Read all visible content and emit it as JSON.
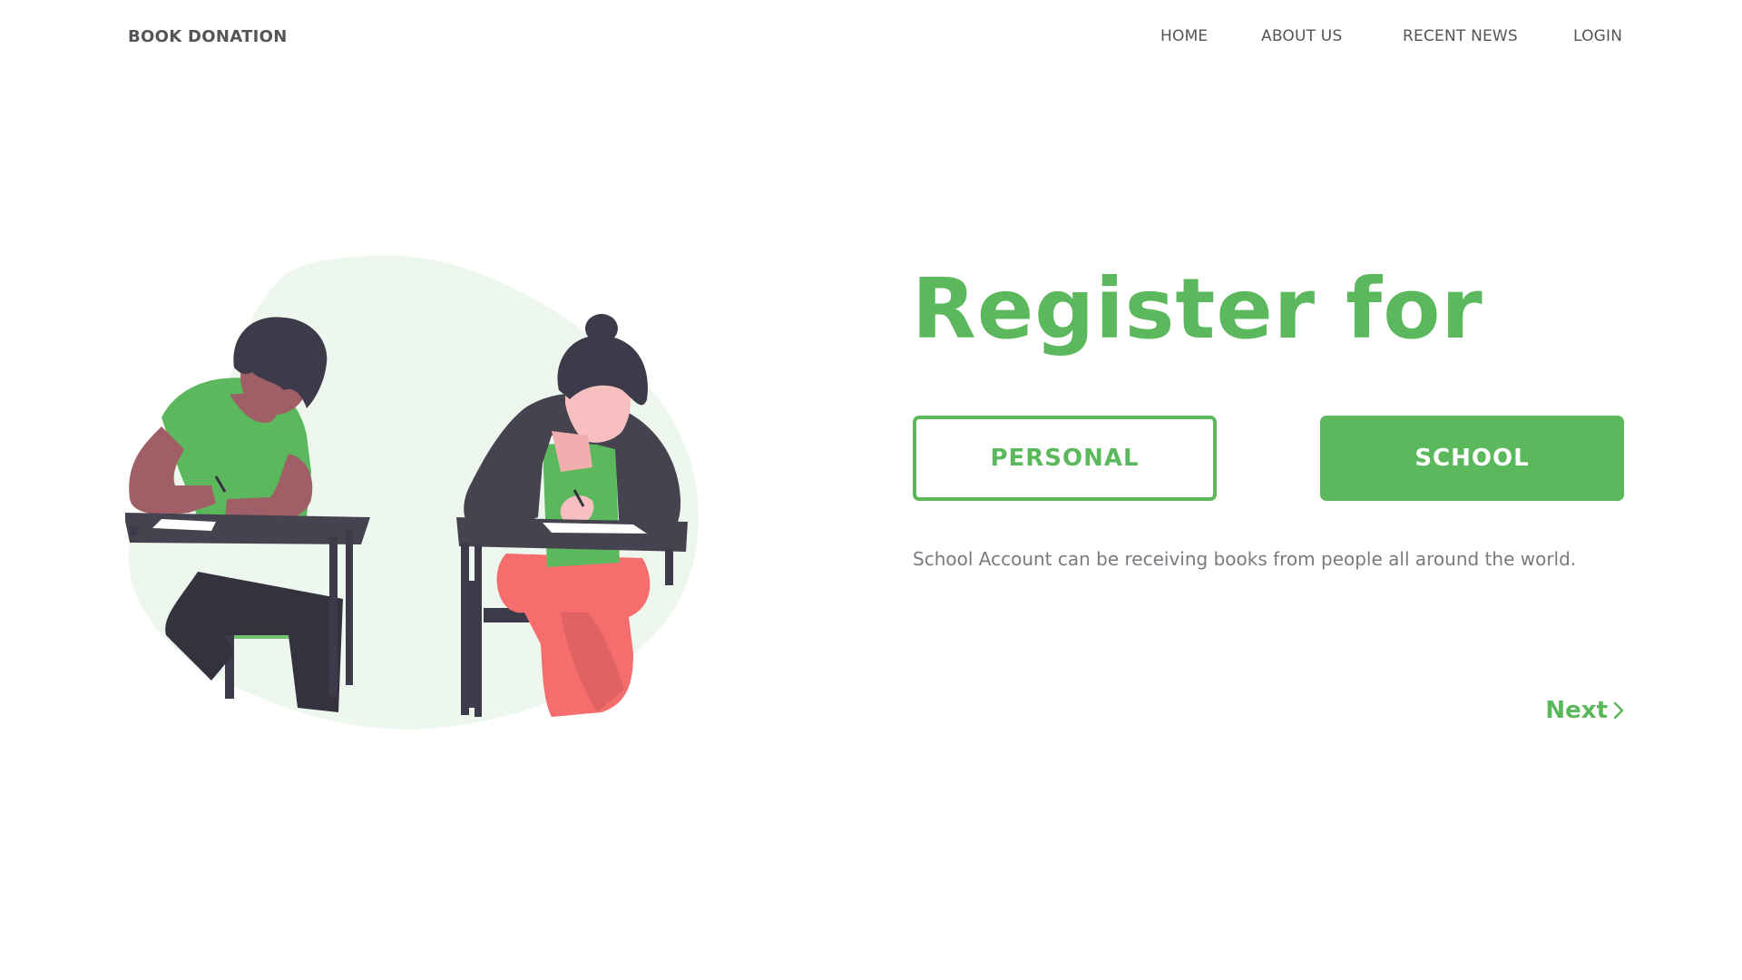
{
  "header": {
    "brand": "BOOK DONATION",
    "nav": [
      {
        "label": "HOME"
      },
      {
        "label": "ABOUT US"
      },
      {
        "label": "RECENT NEWS"
      },
      {
        "label": "LOGIN"
      }
    ]
  },
  "hero": {
    "headline": "Register for",
    "options": {
      "personal_label": "PERSONAL",
      "school_label": "SCHOOL",
      "selected": "SCHOOL"
    },
    "description": "School Account can be receiving books from people all around the world.",
    "next_label": "Next",
    "next_icon": "chevron-right-icon",
    "illustration": "two-students-writing-at-desks"
  },
  "colors": {
    "accent": "#5cb85c",
    "nav_text": "#555459",
    "body_text": "#7a7a80",
    "illustration_bg": "#eef7ee",
    "dark": "#45434f",
    "skin_dark": "#a05e66",
    "skin_light": "#f7bfbf",
    "pants_red": "#f66d6d"
  }
}
